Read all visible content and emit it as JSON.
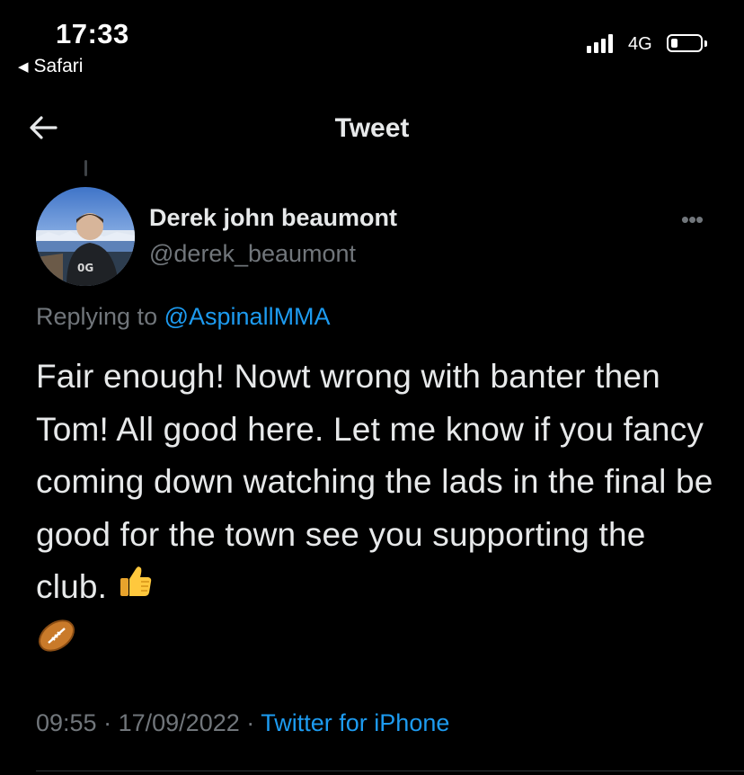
{
  "status_bar": {
    "time": "17:33",
    "back_app": "Safari",
    "network": "4G",
    "signal_bars": 4,
    "battery_level": 0.15
  },
  "nav": {
    "title": "Tweet",
    "back_icon": "arrow-left-icon"
  },
  "tweet": {
    "author_name": "Derek john beaumont",
    "author_handle": "@derek_beaumont",
    "more_icon": "more-icon",
    "replying_prefix": "Replying to",
    "replying_to": "@AspinallMMA",
    "text": "Fair enough! Nowt wrong with banter then Tom! All good here. Let me know if you fancy coming down watching the lads in the final be good for the town see you supporting the club. ",
    "emojis": [
      "thumbs-up-icon",
      "rugby-ball-icon"
    ],
    "time": "09:55",
    "separator": "·",
    "date": "17/09/2022",
    "source": "Twitter for iPhone"
  },
  "colors": {
    "background": "#000000",
    "text": "#e7e9ea",
    "muted": "#71767b",
    "link": "#1d9bf0"
  }
}
